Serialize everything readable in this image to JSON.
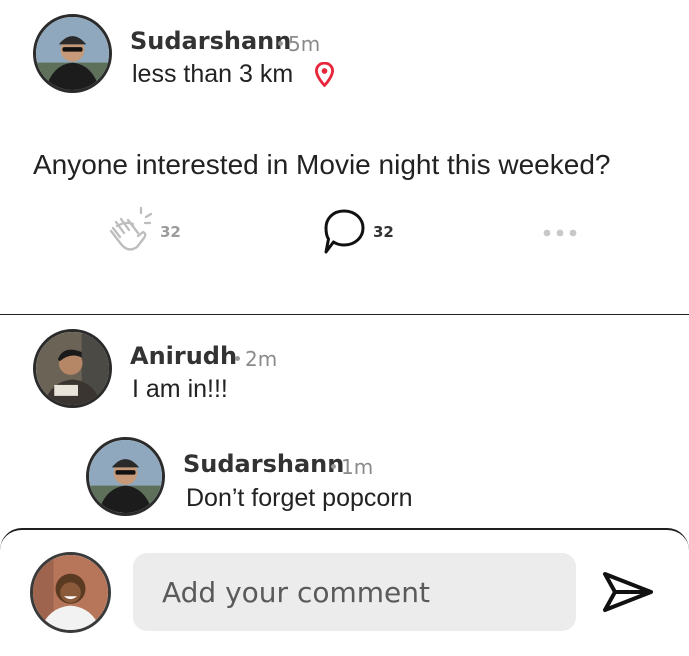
{
  "post": {
    "author": "Sudarshann",
    "time": "5m",
    "distance": "less than 3 km",
    "body": "Anyone interested in Movie night this weeked?",
    "actions": {
      "claps": "32",
      "comments": "32"
    }
  },
  "comments": [
    {
      "author": "Anirudh",
      "time": "2m",
      "text": "I am in!!!"
    },
    {
      "author": "Sudarshann",
      "time": "1m",
      "text": "Don’t forget popcorn"
    }
  ],
  "composer": {
    "placeholder": "Add your comment"
  },
  "colors": {
    "pin": "#e8273d",
    "divider": "#222222",
    "input_bg": "#ececec"
  },
  "icons": [
    "location-pin-icon",
    "clap-icon",
    "comment-bubble-icon",
    "more-icon",
    "send-icon"
  ]
}
